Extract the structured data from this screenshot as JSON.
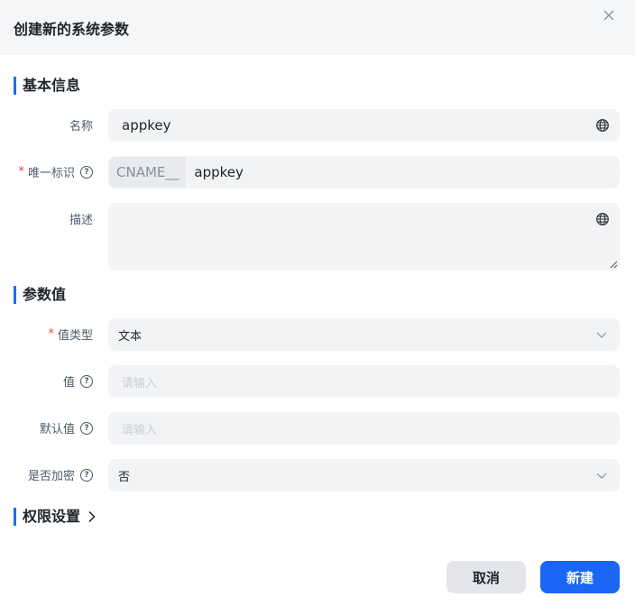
{
  "dialog": {
    "title": "创建新的系统参数"
  },
  "basic": {
    "section_title": "基本信息",
    "name": {
      "label": "名称",
      "value": "appkey"
    },
    "identifier": {
      "required_mark": "*",
      "label": "唯一标识",
      "prefix": "CNAME__",
      "value": "appkey"
    },
    "description": {
      "label": "描述",
      "value": ""
    }
  },
  "param": {
    "section_title": "参数值",
    "value_type": {
      "required_mark": "*",
      "label": "值类型",
      "value": "文本"
    },
    "value": {
      "label": "值",
      "placeholder": "请输入"
    },
    "default_value": {
      "label": "默认值",
      "placeholder": "请输入"
    },
    "encrypted": {
      "label": "是否加密",
      "value": "否"
    }
  },
  "permission": {
    "section_title": "权限设置"
  },
  "footer": {
    "cancel_label": "取消",
    "create_label": "新建"
  },
  "icons": {
    "close": "close-icon",
    "globe": "globe-icon",
    "help": "help-circle-icon",
    "chevron_down": "chevron-down-icon",
    "chevron_right": "chevron-right-icon"
  },
  "colors": {
    "accent": "#1b66f5",
    "required": "#f53f3f",
    "field_bg": "#f2f3f5"
  }
}
